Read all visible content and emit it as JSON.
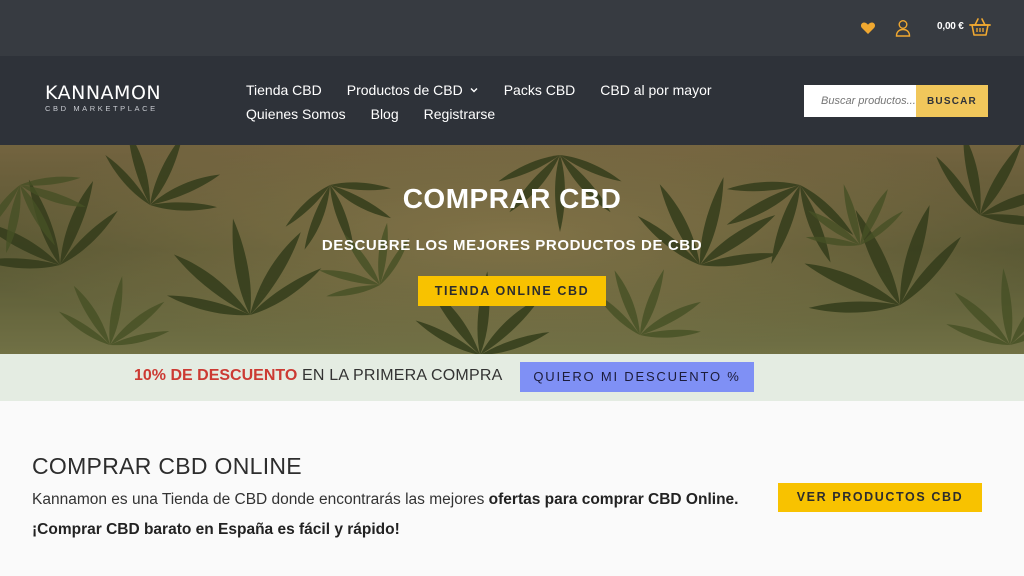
{
  "topbar": {
    "icons": [
      "heart-icon",
      "user-icon",
      "basket-icon"
    ],
    "cart_total": "0,00 €"
  },
  "header": {
    "logo_name": "KANNAMON",
    "logo_sub": "CBD MARKETPLACE",
    "nav": {
      "tienda": "Tienda CBD",
      "productos": "Productos de CBD",
      "packs": "Packs CBD",
      "mayor": "CBD al por mayor",
      "quienes": "Quienes Somos",
      "blog": "Blog",
      "registrarse": "Registrarse"
    },
    "search_placeholder": "Buscar productos...",
    "search_button": "BUSCAR"
  },
  "hero": {
    "title": "COMPRAR CBD",
    "subtitle": "DESCUBRE LOS MEJORES PRODUCTOS DE CBD",
    "cta": "TIENDA ONLINE CBD"
  },
  "promo": {
    "highlight": "10% DE DESCUENTO",
    "rest": " EN LA PRIMERA COMPRA",
    "button": "QUIERO MI DESCUENTO %"
  },
  "main": {
    "heading": "COMPRAR CBD ONLINE",
    "intro_text": "Kannamon es una Tienda de CBD donde encontrarás las mejores ",
    "intro_bold": "ofertas para comprar CBD Online.",
    "tagline": "¡Comprar CBD barato en España es fácil y rápido!",
    "cta": "VER PRODUCTOS CBD"
  },
  "colors": {
    "topbar": "#373b41",
    "header": "#2e3239",
    "accent_yellow": "#f8c200",
    "search_button": "#f1c75b",
    "promo_bg": "#e4ece2",
    "promo_red": "#cc3a33",
    "promo_button": "#7f90f5",
    "heart": "#f0a830"
  }
}
